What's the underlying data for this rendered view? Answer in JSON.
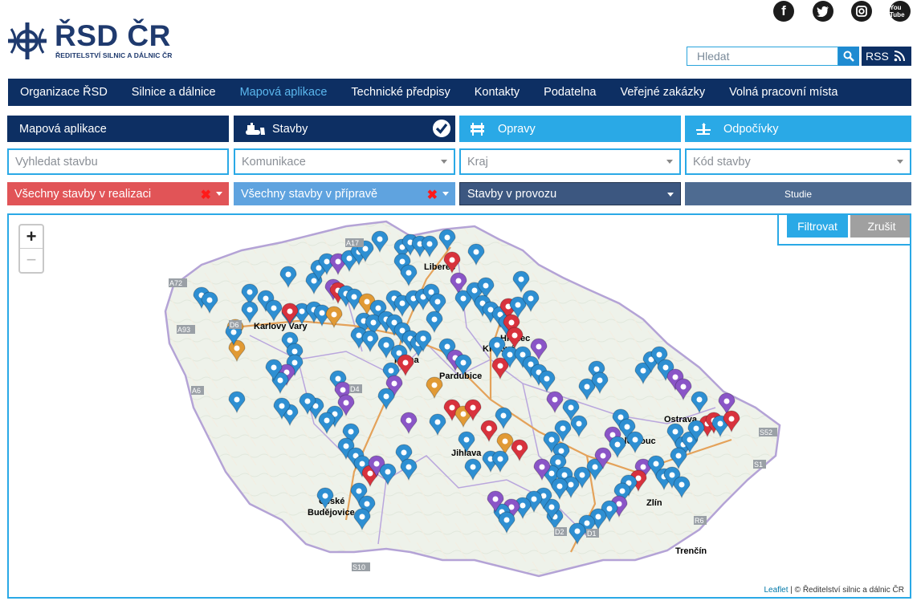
{
  "header": {
    "logo_title": "ŘSD ČR",
    "logo_subtitle": "ŘEDITELSTVÍ SILNIC A DÁLNIC ČR",
    "social": {
      "facebook_label": "f",
      "youtube_label": "You Tube"
    },
    "search_placeholder": "Hledat",
    "rss_label": "RSS"
  },
  "nav": {
    "items": [
      "Organizace ŘSD",
      "Silnice a dálnice",
      "Mapová aplikace",
      "Technické předpisy",
      "Kontakty",
      "Podatelna",
      "Veřejné zakázky",
      "Volná pracovní místa"
    ],
    "active_index": 2
  },
  "tabs": {
    "app": "Mapová aplikace",
    "stavby": "Stavby",
    "opravy": "Opravy",
    "odpocivky": "Odpočívky"
  },
  "filters": {
    "vyhledat": "Vyhledat stavbu",
    "komunikace": "Komunikace",
    "kraj": "Kraj",
    "kod": "Kód stavby"
  },
  "status": {
    "realizace": "Všechny stavby v realizaci",
    "priprava": "Všechny stavby v přípravě",
    "provoz": "Stavby v provozu",
    "studie": "Studie"
  },
  "map": {
    "filter_button": "Filtrovat",
    "cancel_button": "Zrušit",
    "zoom_in": "+",
    "zoom_out": "−",
    "attribution_link": "Leaflet",
    "attribution_text": " | © Ředitelství silnic a dálnic ČR",
    "cities": [
      "Liberec",
      "Hradec",
      "Králové",
      "Pardubice",
      "Jihlava",
      "Olomouc",
      "Ostrava",
      "Zlín",
      "České",
      "Budějovice",
      "Karlovy Vary",
      "Praha",
      "Trenčín"
    ],
    "road_labels": [
      "A17",
      "A72",
      "A93",
      "D6",
      "D4",
      "A6",
      "D1",
      "D2",
      "S52",
      "S1",
      "R6",
      "S10"
    ],
    "marker_colors": {
      "blue": "#2e8fd2",
      "red": "#d8323d",
      "purple": "#8a55c7",
      "orange": "#e19a35"
    }
  }
}
